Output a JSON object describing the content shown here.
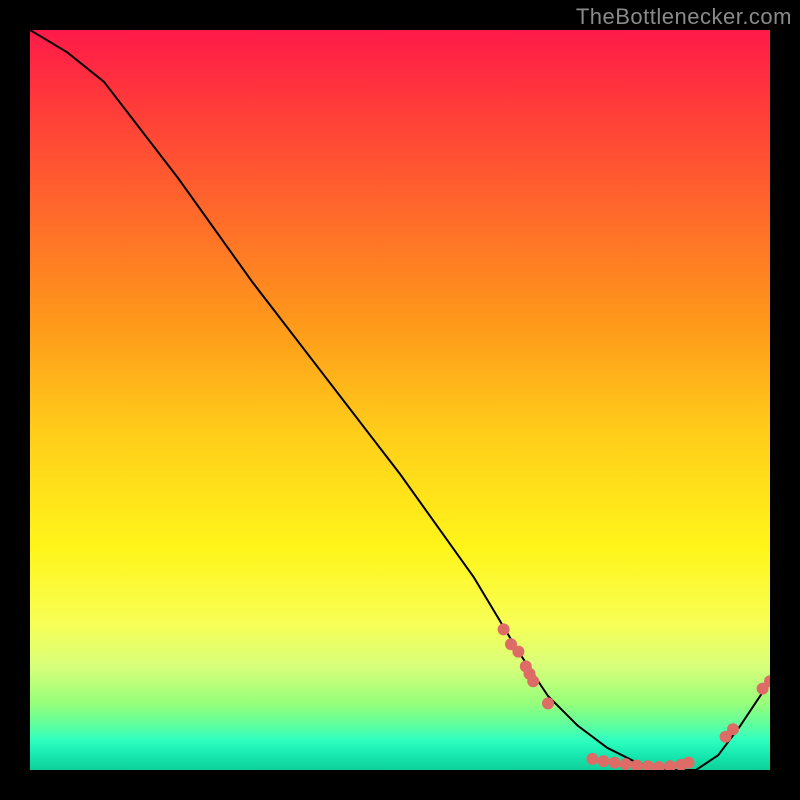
{
  "watermark": "TheBottlenecker.com",
  "chart_data": {
    "type": "line",
    "title": "",
    "xlabel": "",
    "ylabel": "",
    "xlim": [
      0,
      100
    ],
    "ylim": [
      0,
      100
    ],
    "grid": false,
    "legend": "none",
    "background": "red-yellow-green vertical gradient",
    "series": [
      {
        "name": "curve",
        "x": [
          0,
          5,
          10,
          20,
          30,
          40,
          50,
          60,
          66,
          70,
          74,
          78,
          82,
          86,
          90,
          93,
          96,
          100
        ],
        "y": [
          100,
          97,
          93,
          80,
          66,
          53,
          40,
          26,
          16,
          10,
          6,
          3,
          1,
          0,
          0,
          2,
          6,
          12
        ]
      }
    ],
    "markers": [
      {
        "x": 64,
        "y": 19
      },
      {
        "x": 65,
        "y": 17
      },
      {
        "x": 66,
        "y": 16
      },
      {
        "x": 67,
        "y": 14
      },
      {
        "x": 67.5,
        "y": 13
      },
      {
        "x": 68,
        "y": 12
      },
      {
        "x": 70,
        "y": 9
      },
      {
        "x": 76,
        "y": 1.5
      },
      {
        "x": 77.5,
        "y": 1.2
      },
      {
        "x": 79,
        "y": 1.0
      },
      {
        "x": 80.5,
        "y": 0.8
      },
      {
        "x": 82,
        "y": 0.6
      },
      {
        "x": 83.5,
        "y": 0.5
      },
      {
        "x": 85,
        "y": 0.4
      },
      {
        "x": 86.5,
        "y": 0.5
      },
      {
        "x": 88,
        "y": 0.7
      },
      {
        "x": 89,
        "y": 1.0
      },
      {
        "x": 94,
        "y": 4.5
      },
      {
        "x": 95,
        "y": 5.5
      },
      {
        "x": 99,
        "y": 11
      },
      {
        "x": 100,
        "y": 12
      }
    ],
    "marker_color": "#dd6b66",
    "line_color": "#000000"
  }
}
